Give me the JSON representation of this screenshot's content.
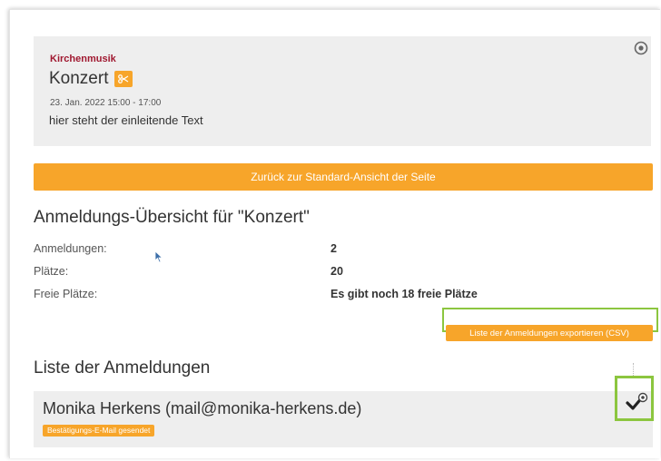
{
  "event": {
    "category": "Kirchenmusik",
    "title": "Konzert",
    "date": "23. Jan. 2022 15:00 - 17:00",
    "intro_text": "hier steht der einleitende Text",
    "badge_icon": "scissors-icon",
    "settings_icon": "settings-circle-icon"
  },
  "back_button_label": "Zurück zur Standard-Ansicht der Seite",
  "overview": {
    "heading": "Anmeldungs-Übersicht für \"Konzert\"",
    "rows": [
      {
        "label": "Anmeldungen:",
        "value": "2"
      },
      {
        "label": "Plätze:",
        "value": "20"
      },
      {
        "label": "Freie Plätze:",
        "value": "Es gibt noch 18 freie Plätze"
      }
    ]
  },
  "export_button_label": "Liste der Anmeldungen exportieren (CSV)",
  "list": {
    "heading": "Liste der Anmeldungen",
    "entries": [
      {
        "name": "Monika Herkens (mail@monika-herkens.de)",
        "status": "Bestätigungs-E-Mail gesendet",
        "action_icon": "checkmark-icon"
      }
    ]
  },
  "colors": {
    "accent": "#f7a52a",
    "category": "#a01830",
    "panel": "#eeeeee",
    "highlight": "#8cc63f"
  }
}
